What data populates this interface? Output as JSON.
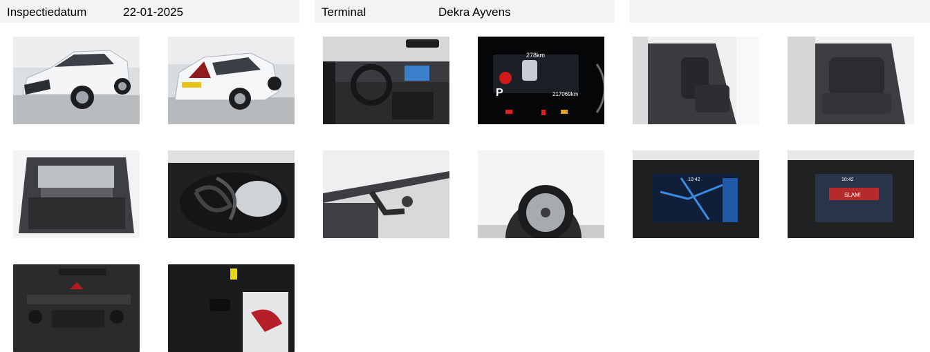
{
  "header": {
    "inspection_date_label": "Inspectiedatum",
    "inspection_date_value": "22-01-2025",
    "terminal_label": "Terminal",
    "terminal_value": "Dekra Ayvens"
  },
  "photos": [
    {
      "subject": "car-front-left-exterior"
    },
    {
      "subject": "car-rear-right-exterior"
    },
    {
      "subject": "dashboard-interior"
    },
    {
      "subject": "instrument-cluster",
      "range_text": "278km",
      "odometer_text": "217069km",
      "gear_text": "P"
    },
    {
      "subject": "front-seats-interior"
    },
    {
      "subject": "rear-seats-interior"
    },
    {
      "subject": "open-trunk"
    },
    {
      "subject": "charging-cables-bag"
    },
    {
      "subject": "tow-hitch"
    },
    {
      "subject": "wheel-rim"
    },
    {
      "subject": "infotainment-navigation",
      "clock_text": "10:42"
    },
    {
      "subject": "infotainment-radio",
      "clock_text": "10:42",
      "station_text": "SLAM!"
    },
    {
      "subject": "center-console-controls"
    },
    {
      "subject": "keys-and-manuals"
    }
  ],
  "colors": {
    "header_bg": "#f3f3f3",
    "car_white": "#f2f4f6",
    "cluster_red": "#e0201a",
    "screen_blue": "#1e5aa8"
  }
}
